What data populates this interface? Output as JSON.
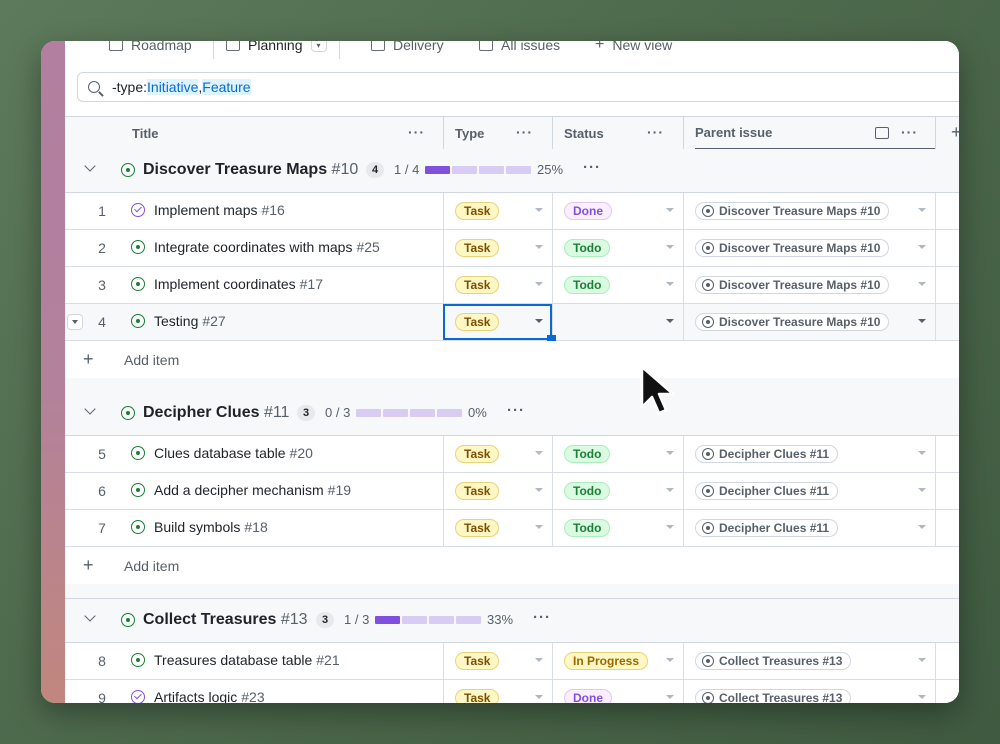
{
  "tabs": [
    {
      "label": "Roadmap"
    },
    {
      "label": "Planning"
    },
    {
      "label": "Delivery"
    },
    {
      "label": "All issues"
    },
    {
      "label": "New view"
    }
  ],
  "filter": {
    "prefix": "-type:",
    "value1": "Initiative",
    "sep": ",",
    "value2": "Feature"
  },
  "columns": {
    "title": "Title",
    "type": "Type",
    "status": "Status",
    "parent": "Parent issue"
  },
  "groups": [
    {
      "title": "Discover Treasure Maps",
      "num": "#10",
      "count": "4",
      "progress_text": "1 / 4",
      "progress": 0.25,
      "pct": "25%",
      "rows": [
        {
          "n": "1",
          "title": "Implement maps",
          "num": "#16",
          "state": "done",
          "type": "Task",
          "status": "Done",
          "parent": "Discover Treasure Maps #10"
        },
        {
          "n": "2",
          "title": "Integrate coordinates with maps",
          "num": "#25",
          "state": "open",
          "type": "Task",
          "status": "Todo",
          "parent": "Discover Treasure Maps #10"
        },
        {
          "n": "3",
          "title": "Implement coordinates",
          "num": "#17",
          "state": "open",
          "type": "Task",
          "status": "Todo",
          "parent": "Discover Treasure Maps #10"
        },
        {
          "n": "4",
          "title": "Testing",
          "num": "#27",
          "state": "open",
          "type": "Task",
          "status": "",
          "parent": "Discover Treasure Maps #10"
        }
      ]
    },
    {
      "title": "Decipher Clues",
      "num": "#11",
      "count": "3",
      "progress_text": "0 / 3",
      "progress": 0,
      "pct": "0%",
      "rows": [
        {
          "n": "5",
          "title": "Clues database table",
          "num": "#20",
          "state": "open",
          "type": "Task",
          "status": "Todo",
          "parent": "Decipher Clues #11"
        },
        {
          "n": "6",
          "title": "Add a decipher mechanism",
          "num": "#19",
          "state": "open",
          "type": "Task",
          "status": "Todo",
          "parent": "Decipher Clues #11"
        },
        {
          "n": "7",
          "title": "Build symbols",
          "num": "#18",
          "state": "open",
          "type": "Task",
          "status": "Todo",
          "parent": "Decipher Clues #11"
        }
      ]
    },
    {
      "title": "Collect Treasures",
      "num": "#13",
      "count": "3",
      "progress_text": "1 / 3",
      "progress": 0.33,
      "pct": "33%",
      "rows": [
        {
          "n": "8",
          "title": "Treasures database table",
          "num": "#21",
          "state": "open",
          "type": "Task",
          "status": "In Progress",
          "parent": "Collect Treasures #13"
        },
        {
          "n": "9",
          "title": "Artifacts logic",
          "num": "#23",
          "state": "done",
          "type": "Task",
          "status": "Done",
          "parent": "Collect Treasures #13"
        }
      ]
    }
  ],
  "add_item_label": "Add item",
  "colors": {
    "open": "#1a7f37",
    "done": "#8250df",
    "accent": "#0969da",
    "progress": "#8250df"
  }
}
